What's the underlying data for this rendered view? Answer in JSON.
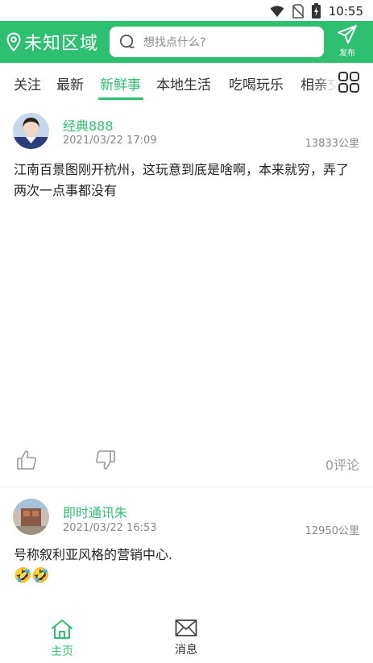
{
  "status_bar": {
    "time": "10:55",
    "icons": [
      "wifi-icon",
      "no-sim-icon",
      "battery-charging-icon"
    ]
  },
  "header": {
    "location_icon": "location-pin-icon",
    "location_label": "未知区域",
    "search_placeholder": "想找点什么?",
    "publish_icon": "paper-plane-icon",
    "publish_label": "发布",
    "accent_color": "#2fbf71"
  },
  "tabs": {
    "items": [
      {
        "label": "关注"
      },
      {
        "label": "最新"
      },
      {
        "label": "新鲜事",
        "active": true
      },
      {
        "label": "本地生活"
      },
      {
        "label": "吃喝玩乐"
      },
      {
        "label": "相亲交友"
      }
    ],
    "grid_icon": "grid-menu-icon"
  },
  "posts": [
    {
      "username": "经典888",
      "time": "2021/03/22 17:09",
      "distance": "13833公里",
      "text": "江南百景图刚开杭州，这玩意到底是啥啊，本来就穷，弄了两次一点事都没有",
      "like_icon": "thumbs-up-icon",
      "dislike_icon": "thumbs-down-icon",
      "comments": "0评论"
    },
    {
      "username": "即时通讯朱",
      "time": "2021/03/22 16:53",
      "distance": "12950公里",
      "text": "号称叙利亚风格的营销中心.",
      "emoji": "🤣🤣"
    }
  ],
  "bottom_nav": {
    "items": [
      {
        "label": "主页",
        "icon": "home-icon",
        "active": true
      },
      {
        "label": "消息",
        "icon": "mail-icon"
      }
    ]
  }
}
